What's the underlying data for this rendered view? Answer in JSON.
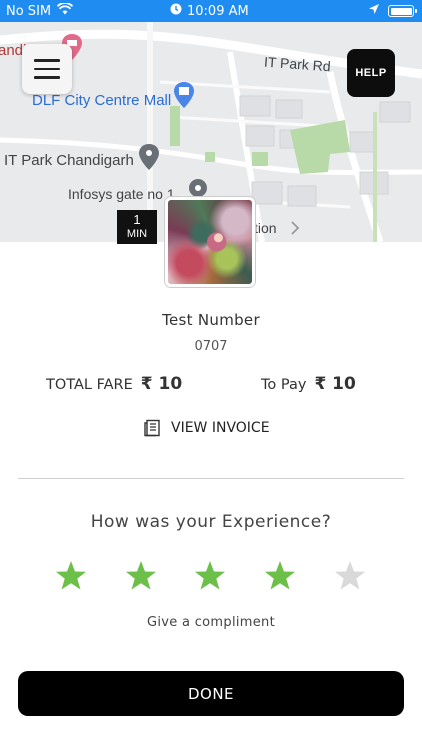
{
  "status_bar": {
    "carrier": "No SIM",
    "time": "10:09 AM"
  },
  "map": {
    "labels": {
      "it_park_rd": "IT Park Rd",
      "dlf_mall": "DLF City Centre Mall",
      "it_park_chandigarh": "IT Park Chandigarh",
      "infosys_gate": "Infosys gate no 1",
      "partial_left": "andi",
      "partial_right": "tion"
    },
    "eta": {
      "value": "1",
      "unit": "MIN"
    }
  },
  "help_label": "HELP",
  "driver": {
    "name": "Test Number",
    "code": "0707"
  },
  "fare": {
    "total_label": "TOTAL FARE",
    "total_amount": "₹ 10",
    "to_pay_label": "To Pay",
    "to_pay_amount": "₹ 10"
  },
  "invoice_label": "VIEW INVOICE",
  "rating": {
    "title": "How was your Experience?",
    "value": 4,
    "max": 5,
    "active_color": "#6cc04a",
    "inactive_color": "#d9d9d9",
    "compliment_label": "Give a compliment"
  },
  "done_label": "DONE"
}
